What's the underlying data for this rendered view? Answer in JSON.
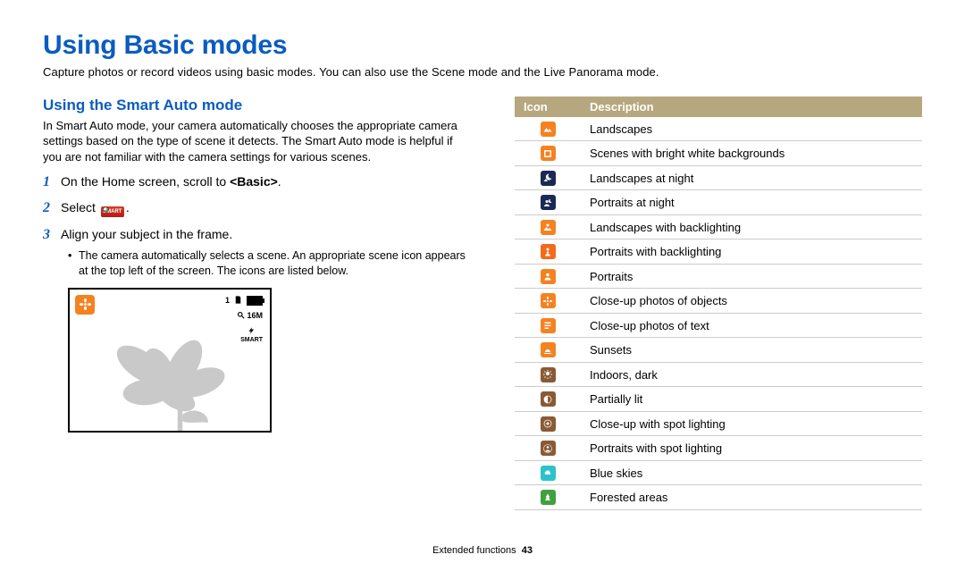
{
  "page": {
    "title": "Using Basic modes",
    "intro": "Capture photos or record videos using basic modes. You can also use the Scene mode and the Live Panorama mode.",
    "section_footer": "Extended functions",
    "page_number": "43"
  },
  "left": {
    "subtitle": "Using the Smart Auto mode",
    "para": "In Smart Auto mode, your camera automatically chooses the appropriate camera settings based on the type of scene it detects. The Smart Auto mode is helpful if you are not familiar with the camera settings for various scenes.",
    "step1_a": "On the Home screen, scroll to ",
    "step1_b": "<Basic>",
    "step1_c": ".",
    "step2_a": "Select ",
    "step2_smart": "SMART",
    "step2_b": ".",
    "step3": "Align your subject in the frame.",
    "step3_sub": "The camera automatically selects a scene. An appropriate scene icon appears at the top left of the screen. The icons are listed below."
  },
  "vf": {
    "count": "1",
    "res": "16M",
    "flash": "SMART"
  },
  "table": {
    "head_icon": "Icon",
    "head_desc": "Description",
    "rows": [
      {
        "color": "c-orange",
        "glyph": "landscape",
        "desc": "Landscapes"
      },
      {
        "color": "c-orange",
        "glyph": "white",
        "desc": "Scenes with bright white backgrounds"
      },
      {
        "color": "c-navy",
        "glyph": "night-land",
        "desc": "Landscapes at night"
      },
      {
        "color": "c-navy",
        "glyph": "night-port",
        "desc": "Portraits at night"
      },
      {
        "color": "c-orange",
        "glyph": "back-land",
        "desc": "Landscapes with backlighting"
      },
      {
        "color": "c-orange2",
        "glyph": "back-port",
        "desc": "Portraits with backlighting"
      },
      {
        "color": "c-orange",
        "glyph": "portrait",
        "desc": "Portraits"
      },
      {
        "color": "c-orange",
        "glyph": "macro-obj",
        "desc": "Close-up photos of objects"
      },
      {
        "color": "c-orange",
        "glyph": "macro-text",
        "desc": "Close-up photos of text"
      },
      {
        "color": "c-sunset",
        "glyph": "sunset",
        "desc": "Sunsets"
      },
      {
        "color": "c-brown",
        "glyph": "indoor",
        "desc": "Indoors, dark"
      },
      {
        "color": "c-brown",
        "glyph": "partial",
        "desc": "Partially lit"
      },
      {
        "color": "c-brown",
        "glyph": "spot-macro",
        "desc": "Close-up with spot lighting"
      },
      {
        "color": "c-brown",
        "glyph": "spot-port",
        "desc": "Portraits with spot lighting"
      },
      {
        "color": "c-teal",
        "glyph": "sky",
        "desc": "Blue skies"
      },
      {
        "color": "c-green",
        "glyph": "forest",
        "desc": "Forested areas"
      }
    ]
  }
}
